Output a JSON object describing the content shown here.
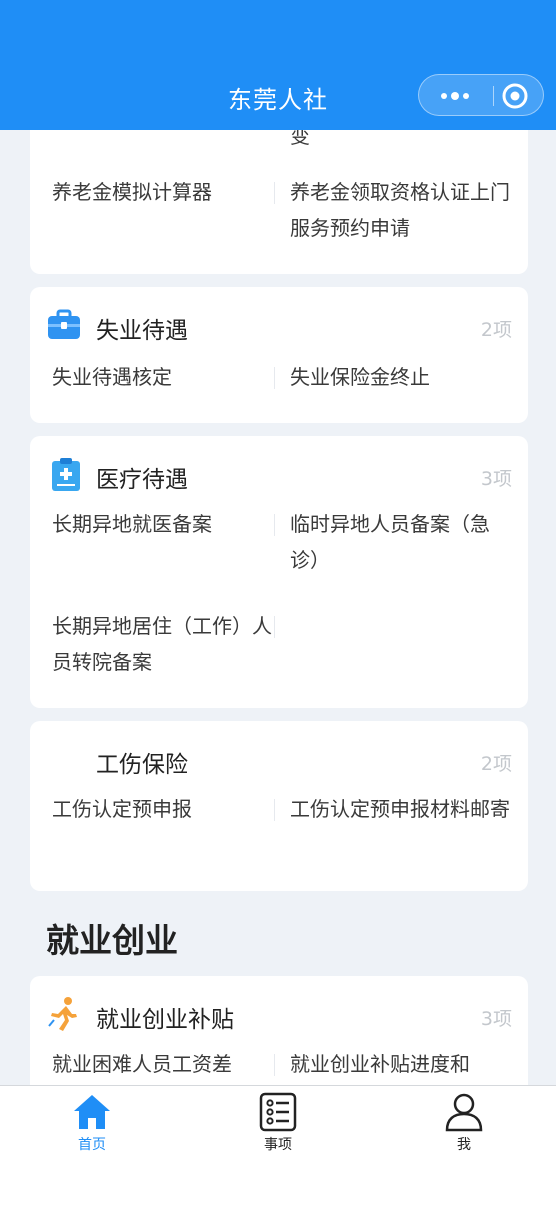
{
  "header": {
    "title": "东莞人社"
  },
  "capsule": {
    "more_icon": "more-dots-icon",
    "close_icon": "target-circle-icon"
  },
  "cards": {
    "pension_partial": {
      "cut_text": "变",
      "items": [
        "养老金模拟计算器",
        "养老金领取资格认证上门服务预约申请"
      ]
    },
    "unemployment": {
      "icon": "briefcase-icon",
      "title": "失业待遇",
      "count": "2项",
      "items": [
        "失业待遇核定",
        "失业保险金终止"
      ]
    },
    "medical": {
      "icon": "clipboard-medical-icon",
      "title": "医疗待遇",
      "count": "3项",
      "items": [
        "长期异地就医备案",
        "临时异地人员备案（急诊）",
        "长期异地居住（工作）人员转院备案"
      ]
    },
    "injury": {
      "title": "工伤保险",
      "count": "2项",
      "items": [
        "工伤认定预申报",
        "工伤认定预申报材料邮寄"
      ]
    },
    "subsidy": {
      "icon": "runner-icon",
      "title": "就业创业补贴",
      "count": "3项",
      "items": [
        "就业困难人员工资差",
        "就业创业补贴进度和"
      ]
    }
  },
  "section": {
    "employment": "就业创业"
  },
  "tabbar": {
    "tabs": [
      {
        "label": "首页",
        "icon": "home-icon",
        "active": true
      },
      {
        "label": "事项",
        "icon": "list-icon",
        "active": false
      },
      {
        "label": "我",
        "icon": "user-icon",
        "active": false
      }
    ]
  },
  "colors": {
    "primary": "#1f8ef6",
    "background": "#eef2f7",
    "count_gray": "#c3c7cc",
    "accent_orange": "#f5a23a"
  }
}
